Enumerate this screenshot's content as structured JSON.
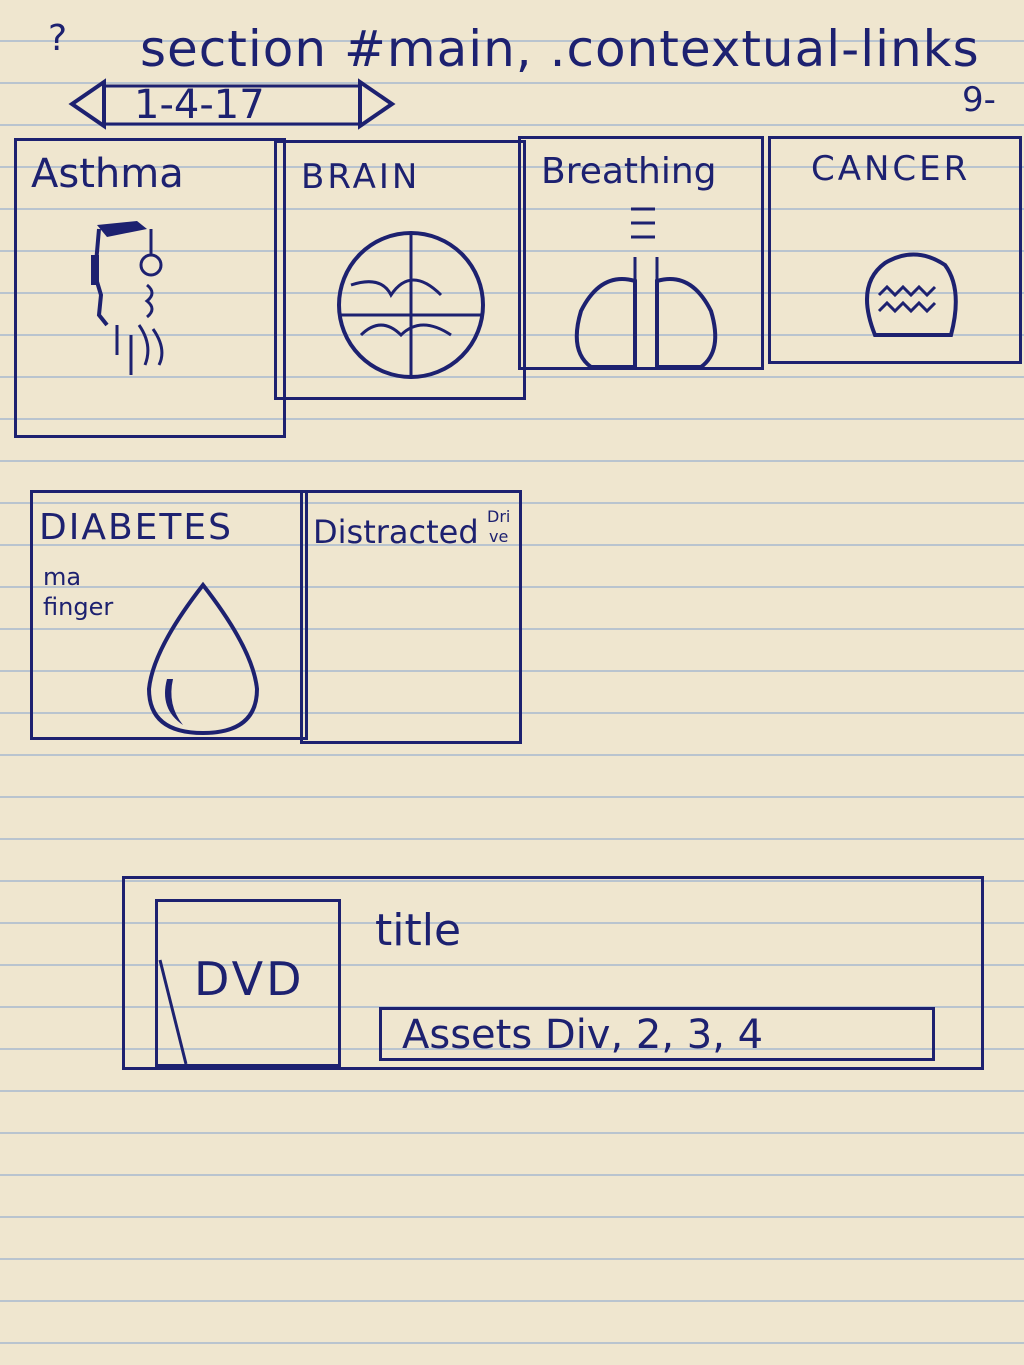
{
  "header": {
    "question_mark": "?",
    "selector": "section #main, .contextual-links",
    "page_number": "9-",
    "pager_label": "1-4-17"
  },
  "tiles": [
    {
      "label": "Asthma"
    },
    {
      "label": "BRAIN"
    },
    {
      "label": "Breathing"
    },
    {
      "label": "CANCER"
    },
    {
      "label": "DIABETES",
      "note_line1": "ma",
      "note_line2": "finger"
    },
    {
      "label": "Distracted",
      "label_suffix_line1": "Dri",
      "label_suffix_line2": "ve"
    }
  ],
  "detail": {
    "media_label": "DVD",
    "title_label": "title",
    "assets_label": "Assets Div, 2, 3, 4"
  }
}
